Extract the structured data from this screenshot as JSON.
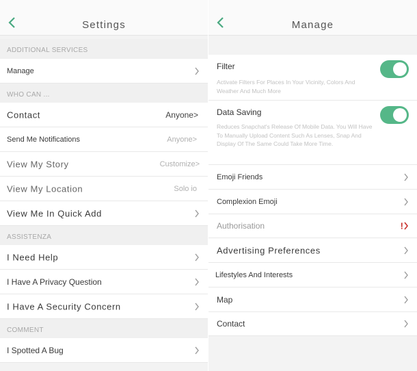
{
  "left": {
    "title": "Settings",
    "sections": {
      "additional_services": "ADDITIONAL SERVICES",
      "who_can": "WHO CAN ...",
      "assistenza": "ASSISTENZA",
      "comment": "COMMENT"
    },
    "rows": {
      "manage": "Manage",
      "contact": {
        "label": "Contact",
        "value": "Anyone>"
      },
      "send_notifications": {
        "label": "Send Me Notifications",
        "value": "Anyone>"
      },
      "view_story": {
        "label": "View My Story",
        "value": "Customize>"
      },
      "view_location": {
        "label": "View My Location",
        "value": "Solo io"
      },
      "quick_add": "View Me In Quick Add",
      "need_help": "I Need Help",
      "privacy_question": "I Have A Privacy Question",
      "security_concern": "I Have A Security Concern",
      "spotted_bug": "I Spotted A Bug"
    }
  },
  "right": {
    "title": "Manage",
    "filter": {
      "title": "Filter",
      "description": "Activate Filters For Places In Your Vicinity, Colors And Weather And Much More",
      "enabled": true
    },
    "data_saving": {
      "title": "Data Saving",
      "description": "Reduces Snapchat's Release Of Mobile Data. You Will Have To Manually Upload Content Such As Lenses, Snap And Display Of The Same Could Take More Time.",
      "enabled": true
    },
    "rows": {
      "emoji_friends": "Emoji Friends",
      "complexion_emoji": "Complexion Emoji",
      "authorisation": "Authorisation",
      "authorisation_alert": "!",
      "advertising": "Advertising Preferences",
      "lifestyles": "Lifestyles And Interests",
      "map": "Map",
      "contact": "Contact"
    }
  },
  "colors": {
    "toggle_on": "#55b788",
    "back_arrow": "#4aa981",
    "alert": "#c9302c"
  },
  "icons": [
    "back-arrow-icon",
    "chevron-right-icon"
  ]
}
